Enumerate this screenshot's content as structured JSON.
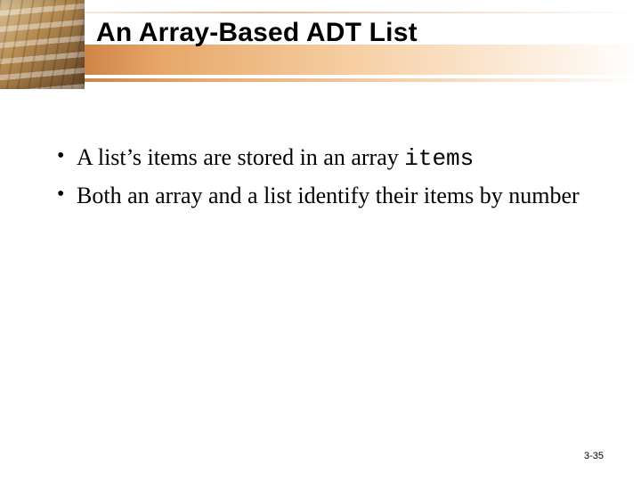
{
  "header": {
    "title": "An Array-Based ADT List"
  },
  "body": {
    "bullets": [
      {
        "pre": "A list’s items are stored in an array ",
        "code": "items",
        "post": ""
      },
      {
        "pre": "Both an array and a list identify their items by number",
        "code": "",
        "post": ""
      }
    ]
  },
  "footer": {
    "page_number": "3-35"
  }
}
